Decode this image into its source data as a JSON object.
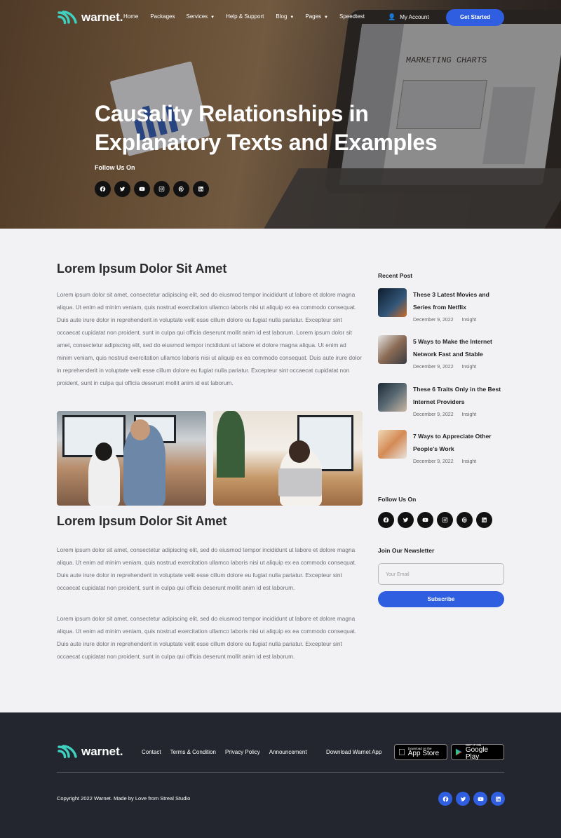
{
  "brand": {
    "name": "warnet.",
    "accent": "#2f5fe0",
    "logo_color": "#3fd0c0"
  },
  "nav": {
    "items": [
      {
        "label": "Home"
      },
      {
        "label": "Packages"
      },
      {
        "label": "Services",
        "dropdown": true
      },
      {
        "label": "Help & Support"
      },
      {
        "label": "Blog",
        "dropdown": true,
        "active": true
      },
      {
        "label": "Pages",
        "dropdown": true
      },
      {
        "label": "Speedtest"
      }
    ],
    "account": "My Account",
    "cta": "Get Started"
  },
  "hero": {
    "title": "Causality Relationships in Explanatory Texts and Examples",
    "follow_label": "Follow Us On",
    "laptop_text": "MARKETING CHARTS"
  },
  "socials": [
    "facebook-icon",
    "twitter-icon",
    "youtube-icon",
    "instagram-icon",
    "pinterest-icon",
    "linkedin-icon"
  ],
  "article": {
    "heading1": "Lorem Ipsum Dolor Sit Amet",
    "para1": "Lorem ipsum dolor sit amet, consectetur adipiscing elit, sed do eiusmod tempor incididunt ut labore et dolore magna aliqua. Ut enim ad minim veniam, quis nostrud exercitation ullamco laboris nisi ut aliquip ex ea commodo consequat. Duis aute irure dolor in reprehenderit in voluptate velit esse cillum dolore eu fugiat nulla pariatur. Excepteur sint occaecat cupidatat non proident, sunt in culpa qui officia deserunt mollit anim id est laborum. Lorem ipsum dolor sit amet, consectetur adipiscing elit, sed do eiusmod tempor incididunt ut labore et dolore magna aliqua. Ut enim ad minim veniam, quis nostrud exercitation ullamco laboris nisi ut aliquip ex ea commodo consequat. Duis aute irure dolor in reprehenderit in voluptate velit esse cillum dolore eu fugiat nulla pariatur. Excepteur sint occaecat cupidatat non proident, sunt in culpa qui officia deserunt mollit anim id est laborum.",
    "heading2": "Lorem Ipsum Dolor Sit Amet",
    "para2": "Lorem ipsum dolor sit amet, consectetur adipiscing elit, sed do eiusmod tempor incididunt ut labore et dolore magna aliqua. Ut enim ad minim veniam, quis nostrud exercitation ullamco laboris nisi ut aliquip ex ea commodo consequat. Duis aute irure dolor in reprehenderit in voluptate velit esse cillum dolore eu fugiat nulla pariatur. Excepteur sint occaecat cupidatat non proident, sunt in culpa qui officia deserunt mollit anim id est laborum.",
    "para3": "Lorem ipsum dolor sit amet, consectetur adipiscing elit, sed do eiusmod tempor incididunt ut labore et dolore magna aliqua. Ut enim ad minim veniam, quis nostrud exercitation ullamco laboris nisi ut aliquip ex ea commodo consequat. Duis aute irure dolor in reprehenderit in voluptate velit esse cillum dolore eu fugiat nulla pariatur. Excepteur sint occaecat cupidatat non proident, sunt in culpa qui officia deserunt mollit anim id est laborum."
  },
  "sidebar": {
    "recent_title": "Recent Post",
    "posts": [
      {
        "title": "These 3 Latest Movies and Series from Netflix",
        "date": "December 9, 2022",
        "category": "Insight"
      },
      {
        "title": "5 Ways to Make the Internet Network Fast and Stable",
        "date": "December 9, 2022",
        "category": "Insight"
      },
      {
        "title": "These 6 Traits Only in the Best Internet Providers",
        "date": "December 9, 2022",
        "category": "Insight"
      },
      {
        "title": "7 Ways to Appreciate Other People's Work",
        "date": "December 9, 2022",
        "category": "Insight"
      }
    ],
    "follow_title": "Follow Us On",
    "newsletter_title": "Join Our Newsletter",
    "email_placeholder": "Your Email",
    "subscribe_label": "Subscribe"
  },
  "footer": {
    "links": [
      "Contact",
      "Terms & Condition",
      "Privacy Policy",
      "Announcement"
    ],
    "download_label": "Download Warnet App",
    "appstore_small": "Download on the",
    "appstore_big": "App Store",
    "googleplay_small": "GET IT ON",
    "googleplay_big": "Google Play",
    "copyright": "Copyright 2022 Warnet. Made by Love from Streal Studio",
    "socials": [
      "facebook-icon",
      "twitter-icon",
      "youtube-icon",
      "linkedin-icon"
    ]
  }
}
